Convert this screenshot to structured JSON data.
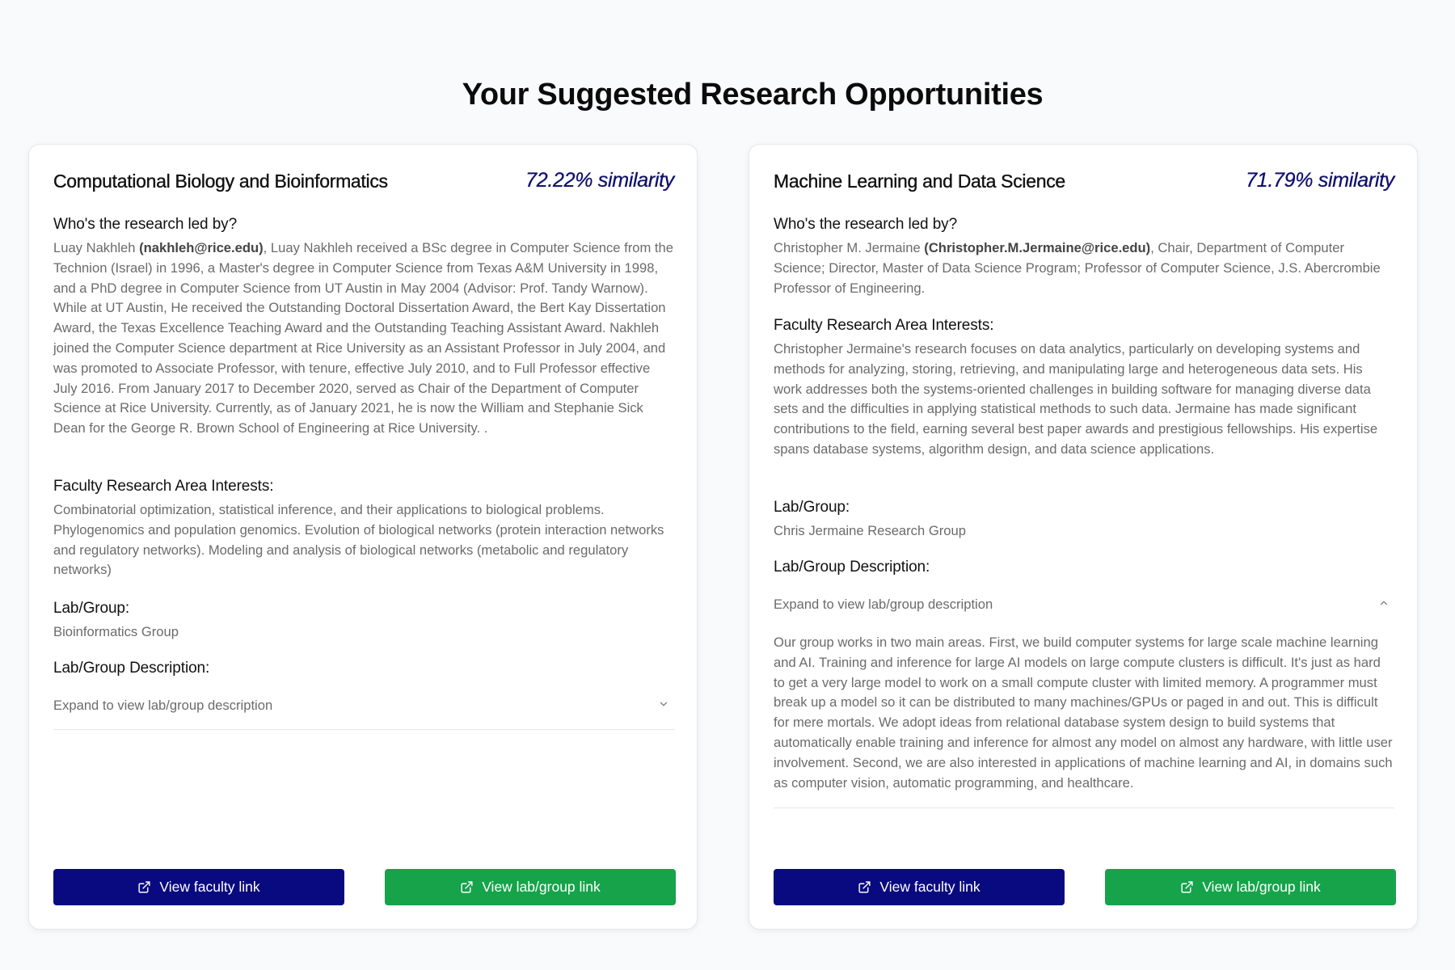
{
  "page": {
    "title": "Your Suggested Research Opportunities"
  },
  "labels": {
    "led_by_heading": "Who's the research led by?",
    "interests_heading": "Faculty Research Area Interests:",
    "lab_heading": "Lab/Group:",
    "lab_desc_heading": "Lab/Group Description:",
    "expand_label": "Expand to view lab/group description",
    "faculty_button": "View faculty link",
    "lab_button": "View lab/group link"
  },
  "colors": {
    "faculty_button": "#0a0a80",
    "lab_button": "#16a34a",
    "similarity_text": "#10106e"
  },
  "icons": {
    "button_icon": "external-link-icon",
    "collapsed": "chevron-down-icon",
    "expanded": "chevron-up-icon"
  },
  "cards": [
    {
      "title": "Computational Biology and Bioinformatics",
      "similarity": "72.22% similarity",
      "leader_name": "Luay Nakhleh ",
      "leader_email": "(nakhleh@rice.edu)",
      "leader_bio": ", Luay Nakhleh received a BSc degree in Computer Science from the Technion (Israel) in 1996, a Master's degree in Computer Science from Texas A&M University in 1998, and a PhD degree in Computer Science from UT Austin in May 2004 (Advisor: Prof. Tandy Warnow). While at UT Austin, He received the Outstanding Doctoral Dissertation Award, the Bert Kay Dissertation Award, the Texas Excellence Teaching Award and the Outstanding Teaching Assistant Award. Nakhleh joined the Computer Science department at Rice University as an Assistant Professor in July 2004, and was promoted to Associate Professor, with tenure, effective July 2010, and to Full Professor effective July 2016. From January 2017 to December 2020, served as Chair of the Department of Computer Science at Rice University. Currently, as of January 2021, he is now the William and Stephanie Sick Dean for the George R. Brown School of Engineering at Rice University. .",
      "interests": "Combinatorial optimization, statistical inference, and their applications to biological problems. Phylogenomics and population genomics. Evolution of biological networks (protein interaction networks and regulatory networks). Modeling and analysis of biological networks (metabolic and regulatory networks)",
      "lab": "Bioinformatics Group",
      "expanded": false,
      "lab_description": ""
    },
    {
      "title": "Machine Learning and Data Science",
      "similarity": "71.79% similarity",
      "leader_name": "Christopher M. Jermaine ",
      "leader_email": "(Christopher.M.Jermaine@rice.edu)",
      "leader_bio": ", Chair, Department of Computer Science; Director, Master of Data Science Program; Professor of Computer Science, J.S. Abercrombie Professor of Engineering.",
      "interests": "Christopher Jermaine's research focuses on data analytics, particularly on developing systems and methods for analyzing, storing, retrieving, and manipulating large and heterogeneous data sets. His work addresses both the systems-oriented challenges in building software for managing diverse data sets and the difficulties in applying statistical methods to such data. Jermaine has made significant contributions to the field, earning several best paper awards and prestigious fellowships. His expertise spans database systems, algorithm design, and data science applications.",
      "lab": "Chris Jermaine Research Group",
      "expanded": true,
      "lab_description": "Our group works in two main areas. First, we build computer systems for large scale machine learning and AI. Training and inference for large AI models on large compute clusters is difficult. It's just as hard to get a very large model to work on a small compute cluster with limited memory. A programmer must break up a model so it can be distributed to many machines/GPUs or paged in and out. This is difficult for mere mortals. We adopt ideas from relational database system design to build systems that automatically enable training and inference for almost any model on almost any hardware, with little user involvement. Second, we are also interested in applications of machine learning and AI, in domains such as computer vision, automatic programming, and healthcare."
    }
  ]
}
